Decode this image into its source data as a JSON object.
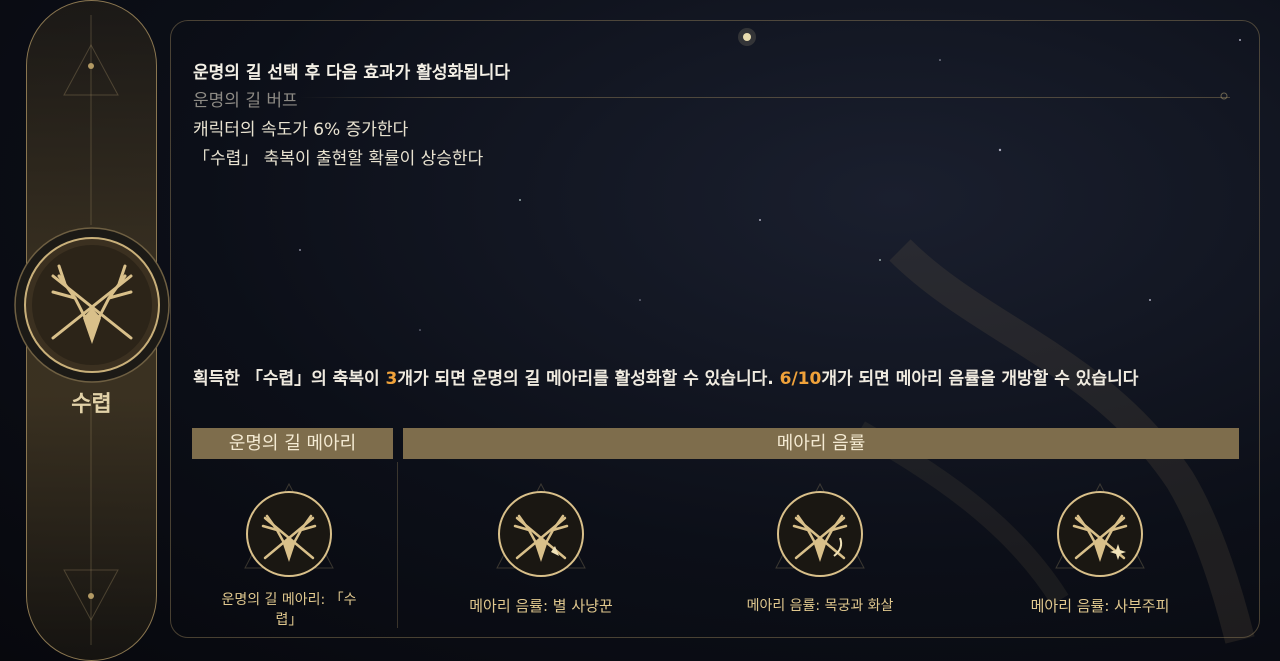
{
  "pillar": {
    "label": "수렵",
    "emblem_icon": "stag-crossed-arrows-icon"
  },
  "effects": {
    "heading": "운명의 길 선택 후 다음 효과가 활성화됩니다",
    "buff_title": "운명의 길 버프",
    "lines": [
      "캐릭터의 속도가 6% 증가한다",
      "「수렵」 축복이 출현할 확률이 상승한다"
    ]
  },
  "condition": {
    "part1": "획득한 「수렵」의 축복이 ",
    "count_required": "3",
    "part2": "개가 되면 운명의 길 메아리를 활성화할 수 있습니다. ",
    "progress": "6/10",
    "part3": "개가 되면 메아리 음률을 개방할 수 있습니다"
  },
  "sections": {
    "echo_header": "운명의 길 메아리",
    "melody_header": "메아리 음률"
  },
  "echo_item": {
    "label": "운명의 길 메아리: 「수렵」",
    "icon": "stag-emblem-icon"
  },
  "melodies": [
    {
      "label": "메아리 음률: 별 사냥꾼",
      "icon": "stag-star-icon"
    },
    {
      "label": "메아리 음률: 목궁과 화살",
      "icon": "stag-bow-icon"
    },
    {
      "label": "메아리 음률: 사부주피",
      "icon": "stag-sparkle-icon"
    }
  ],
  "colors": {
    "accent": "#f0a23a",
    "header_bg": "#7e6d4c",
    "gold": "#d9c08a"
  }
}
